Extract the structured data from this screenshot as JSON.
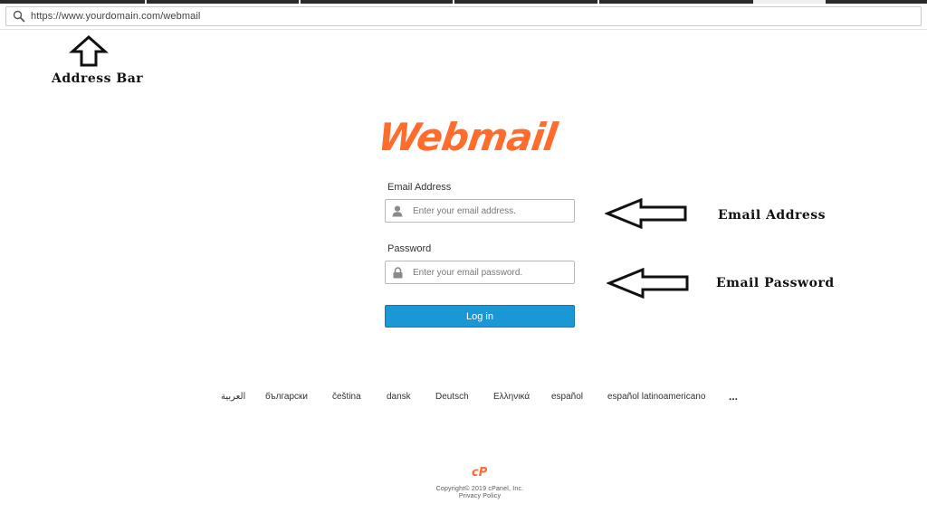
{
  "browser": {
    "url": "https://www.yourdomain.com/webmail"
  },
  "annotations": {
    "address_bar": "Address Bar",
    "email_address": "Email Address",
    "email_password": "Email Password"
  },
  "logo": {
    "text": "Webmail",
    "color": "#ff6c2c"
  },
  "form": {
    "email_label": "Email Address",
    "email_placeholder": "Enter your email address.",
    "password_label": "Password",
    "password_placeholder": "Enter your email password.",
    "login_label": "Log in",
    "button_color": "#1a98d6"
  },
  "languages": [
    "العربية",
    "български",
    "čeština",
    "dansk",
    "Deutsch",
    "Ελληνικά",
    "español",
    "español latinoamericano",
    "..."
  ],
  "footer": {
    "logo_text": "cP",
    "copyright": "Copyright© 2019 cPanel, Inc.",
    "privacy": "Privacy Policy"
  }
}
